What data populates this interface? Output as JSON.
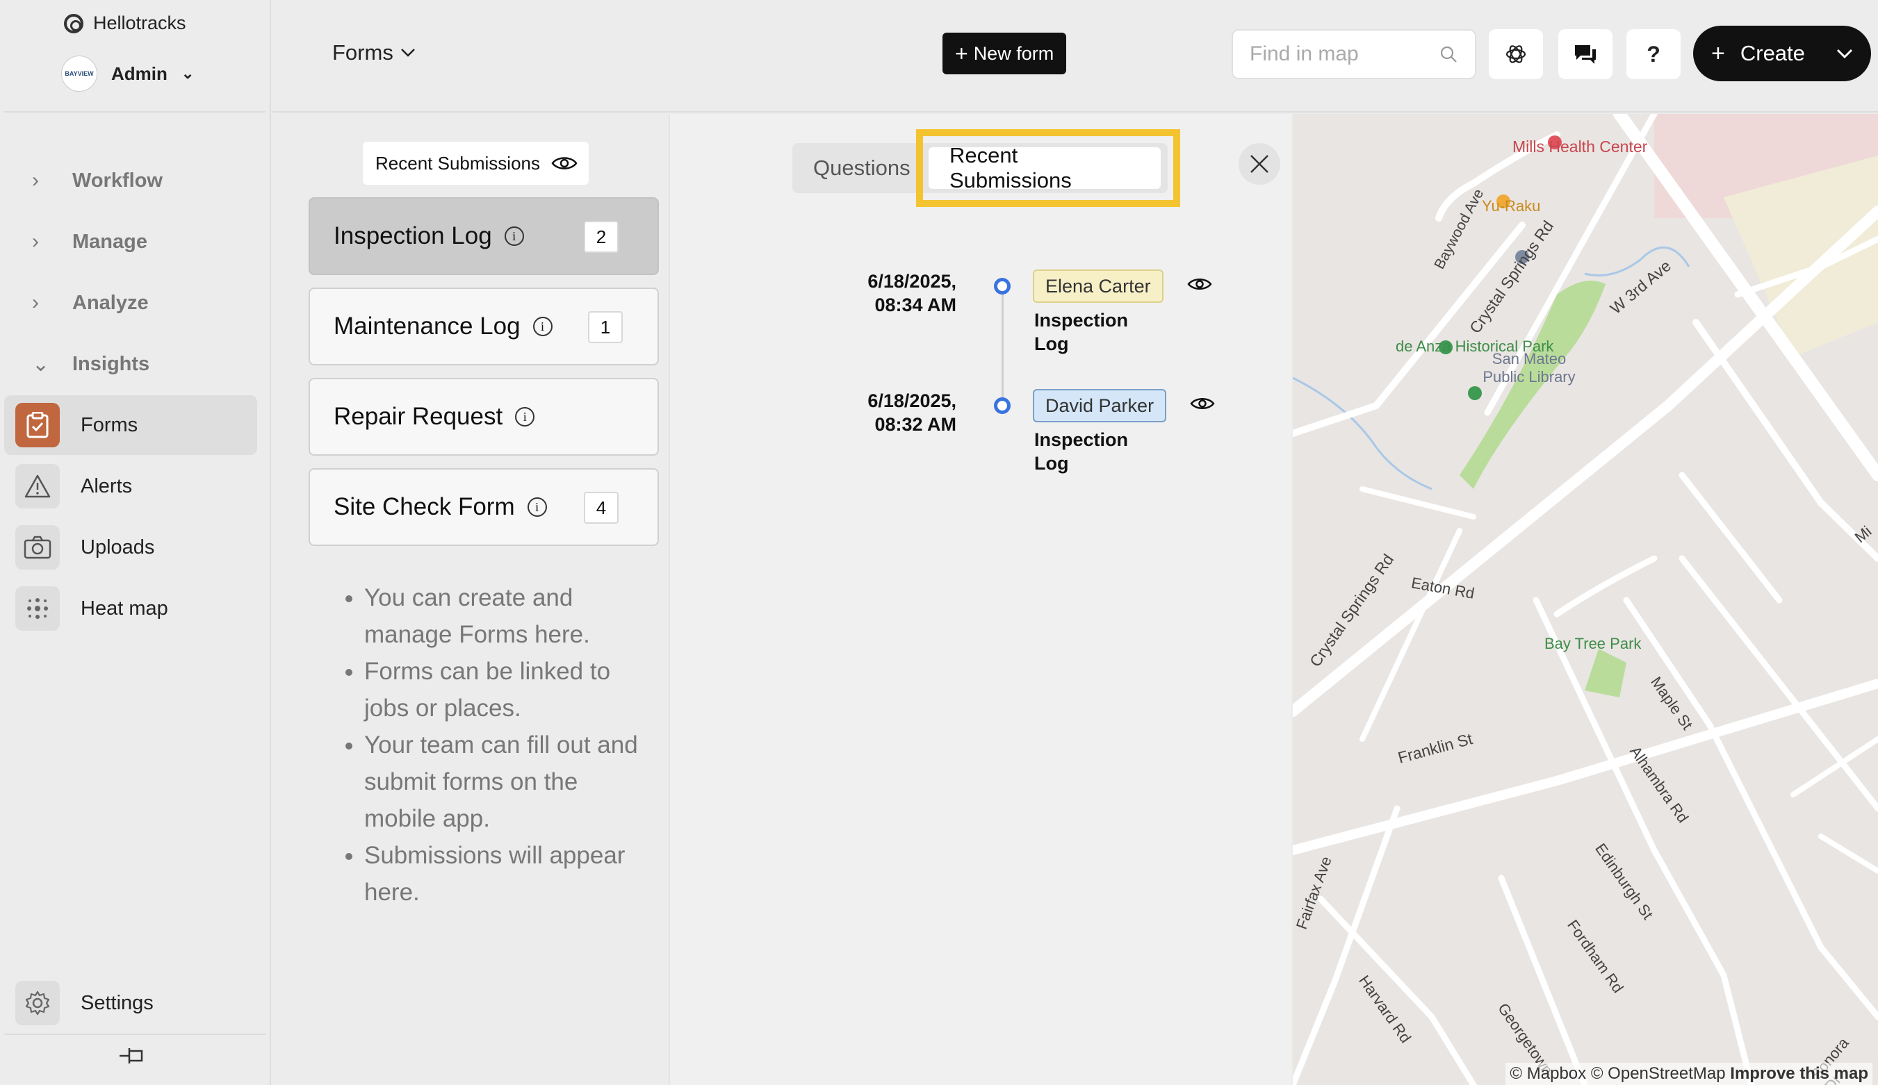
{
  "sidebar": {
    "brand": "Hellotracks",
    "user": "Admin",
    "avatar_text": "BAYVIEW",
    "sections": [
      {
        "label": "Workflow",
        "chevron": "›"
      },
      {
        "label": "Manage",
        "chevron": "›"
      },
      {
        "label": "Analyze",
        "chevron": "›"
      },
      {
        "label": "Insights",
        "chevron": "⌄"
      }
    ],
    "items": [
      {
        "label": "Forms",
        "icon": "clipboard-icon",
        "active": true
      },
      {
        "label": "Alerts",
        "icon": "warning-icon"
      },
      {
        "label": "Uploads",
        "icon": "camera-icon"
      },
      {
        "label": "Heat map",
        "icon": "heatmap-icon"
      }
    ],
    "settings_label": "Settings"
  },
  "topbar": {
    "section_title": "Forms",
    "new_form_label": "New form",
    "search_placeholder": "Find in map",
    "help_label": "?",
    "create_label": "Create"
  },
  "forms_panel": {
    "recent_submissions_label": "Recent Submissions",
    "forms": [
      {
        "name": "Inspection Log",
        "count": "2",
        "selected": true
      },
      {
        "name": "Maintenance Log",
        "count": "1"
      },
      {
        "name": "Repair Request",
        "count": ""
      },
      {
        "name": "Site Check Form",
        "count": "4"
      }
    ],
    "help": [
      "You can create and manage Forms here.",
      "Forms can be linked to jobs or places.",
      "Your team can fill out and submit forms on the mobile app.",
      "Submissions will appear here."
    ]
  },
  "submissions_panel": {
    "tabs": [
      "Questions",
      "Recent Submissions"
    ],
    "active_tab": "Recent Submissions",
    "submissions": [
      {
        "date": "6/18/2025,",
        "time": "08:34 AM",
        "name": "Elena Carter",
        "form_line1": "Inspection",
        "form_line2": "Log",
        "color": "yellow"
      },
      {
        "date": "6/18/2025,",
        "time": "08:32 AM",
        "name": "David Parker",
        "form_line1": "Inspection",
        "form_line2": "Log",
        "color": "blue"
      }
    ]
  },
  "map": {
    "labels": {
      "mills": "Mills Health Center",
      "yuraku": "Yu-Raku",
      "baywood": "Baywood Ave",
      "crystal1": "Crystal Springs Rd",
      "w3rd": "W 3rd Ave",
      "deanza": "de Anza Historical Park",
      "library1": "San Mateo",
      "library2": "Public Library",
      "crystal2": "Crystal Springs Rd",
      "eaton": "Eaton Rd",
      "baytree": "Bay Tree Park",
      "maple": "Maple St",
      "franklin": "Franklin St",
      "alhambra": "Alhambra Rd",
      "fairfax": "Fairfax Ave",
      "edinburgh": "Edinburgh St",
      "fordham": "Fordham Rd",
      "harvard": "Harvard Rd",
      "georgetown": "Georgetown",
      "sonora": "Sonora Dr",
      "mi": "Mi"
    },
    "attribution_1": "© Mapbox © OpenStreetMap",
    "attribution_2": "Improve this map"
  }
}
